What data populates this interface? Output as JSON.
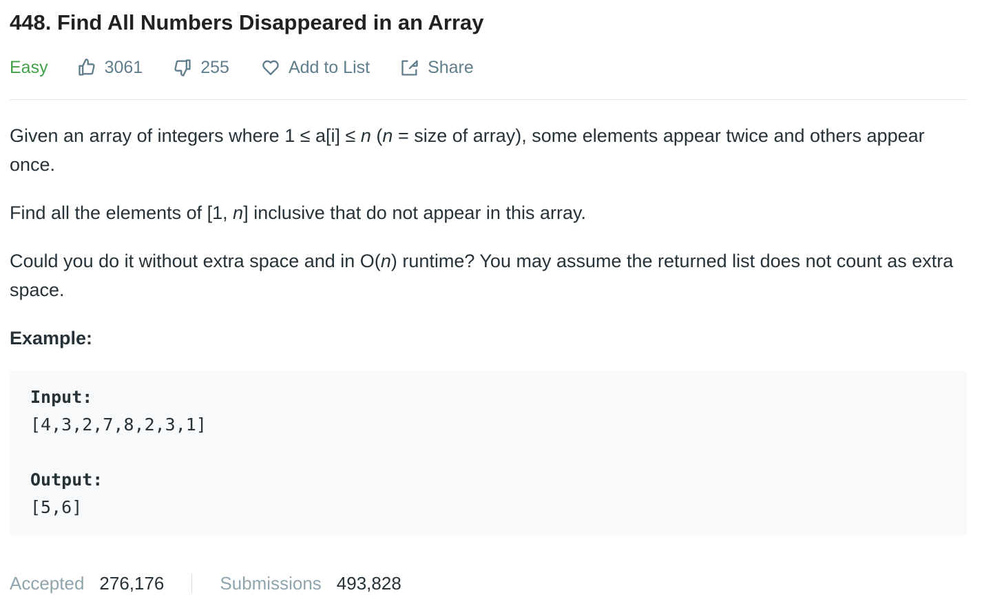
{
  "problem": {
    "title": "448. Find All Numbers Disappeared in an Array",
    "difficulty": "Easy",
    "likes": "3061",
    "dislikes": "255",
    "add_to_list_label": "Add to List",
    "share_label": "Share"
  },
  "description": {
    "p1_a": "Given an array of integers where 1 ≤ a[i] ≤ ",
    "p1_n": "n",
    "p1_b": " (",
    "p1_n2": "n",
    "p1_c": " = size of array), some elements appear twice and others appear once.",
    "p2_a": "Find all the elements of [1, ",
    "p2_n": "n",
    "p2_b": "] inclusive that do not appear in this array.",
    "p3_a": "Could you do it without extra space and in O(",
    "p3_n": "n",
    "p3_b": ") runtime? You may assume the returned list does not count as extra space."
  },
  "example": {
    "label": "Example:",
    "input_label": "Input:",
    "input_value": "[4,3,2,7,8,2,3,1]",
    "output_label": "Output:",
    "output_value": "[5,6]"
  },
  "stats": {
    "accepted_label": "Accepted",
    "accepted_value": "276,176",
    "submissions_label": "Submissions",
    "submissions_value": "493,828"
  },
  "colors": {
    "easy": "#43a047",
    "meta": "#607d8b",
    "text": "#263238",
    "code_bg": "#f7f9fa"
  },
  "icons": {
    "like": "thumbs-up-icon",
    "dislike": "thumbs-down-icon",
    "add_to_list": "heart-icon",
    "share": "share-icon"
  }
}
